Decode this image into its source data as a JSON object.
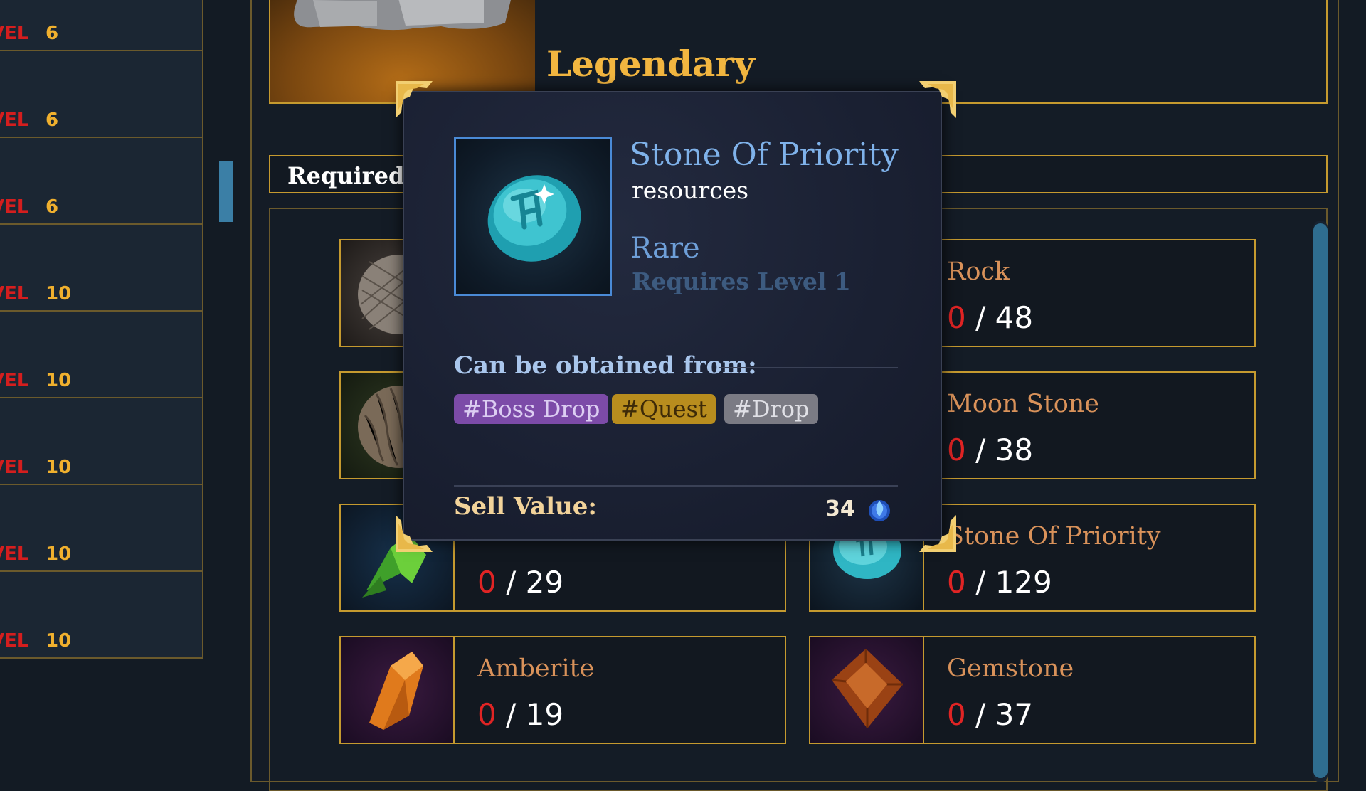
{
  "left_list": {
    "level_prefix": "VEL",
    "rows": [
      {
        "level": "6"
      },
      {
        "level": "6"
      },
      {
        "level": "6"
      },
      {
        "level": "10"
      },
      {
        "level": "10"
      },
      {
        "level": "10"
      },
      {
        "level": "10"
      },
      {
        "level": "10"
      }
    ]
  },
  "header": {
    "rarity": "Legendary",
    "required_label": "Required R"
  },
  "resources": [
    {
      "name": "Rock",
      "have": "0",
      "need": "48",
      "icon": "mesh-ore-icon"
    },
    {
      "name": "Moon Stone",
      "have": "0",
      "need": "38",
      "icon": "fibrous-ore-icon"
    },
    {
      "name": "",
      "have": "0",
      "need": "29",
      "icon": "green-crystal-icon"
    },
    {
      "name": "Stone Of Priority",
      "have": "0",
      "need": "129",
      "icon": "rune-stone-icon"
    },
    {
      "name": "Amberite",
      "have": "0",
      "need": "19",
      "icon": "amber-crystal-icon"
    },
    {
      "name": "Gemstone",
      "have": "0",
      "need": "37",
      "icon": "square-gem-icon"
    }
  ],
  "tooltip": {
    "name": "Stone Of Priority",
    "type": "resources",
    "rarity": "Rare",
    "requirement": "Requires Level 1",
    "obtained_label": "Can be obtained from:",
    "tags": [
      "#Boss Drop",
      "#Quest",
      "#Drop"
    ],
    "sell_label": "Sell Value:",
    "sell_value": "34",
    "currency_icon": "blue-gem-coin-icon"
  },
  "colors": {
    "gold_border": "#c59a2f",
    "count_have": "#e02424",
    "rare_blue": "#7fb2ea",
    "level_red": "#d41e1e",
    "level_gold": "#f0b02e"
  }
}
